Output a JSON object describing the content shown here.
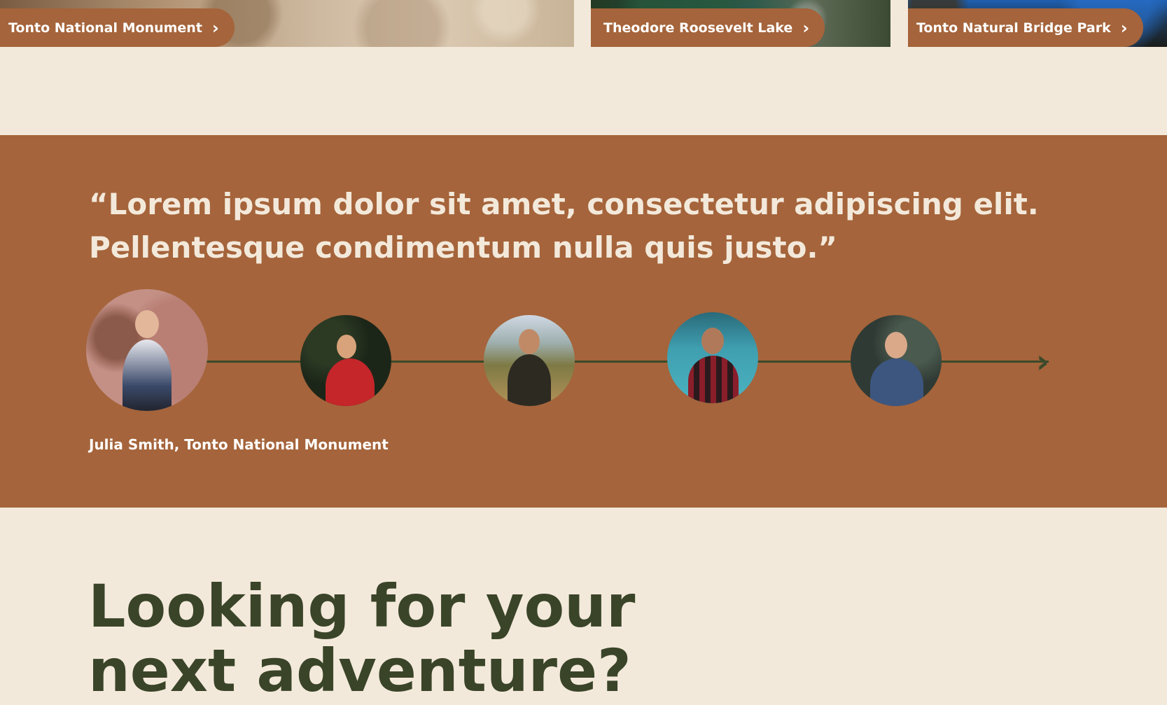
{
  "cards": [
    {
      "label": "Tonto National Monument",
      "icon": "chevron-right-icon"
    },
    {
      "label": "Theodore Roosevelt Lake",
      "icon": "chevron-right-icon"
    },
    {
      "label": "Tonto Natural Bridge Park",
      "icon": "chevron-right-icon"
    }
  ],
  "testimonial": {
    "quote_line_1": "“Lorem ipsum dolor sit amet, consectetur adipiscing elit.",
    "quote_line_2": "Pellentesque condimentum nulla quis justo.”",
    "author": "Julia Smith, Tonto National Monument",
    "next_icon": "chevron-right-icon",
    "active_index": 0,
    "count": 5
  },
  "heading": {
    "line_1": "Looking for your",
    "line_2": "next adventure?"
  },
  "colors": {
    "background": "#f3e9db",
    "accent": "#a5643b",
    "dark_green": "#3a4428",
    "white": "#ffffff"
  }
}
